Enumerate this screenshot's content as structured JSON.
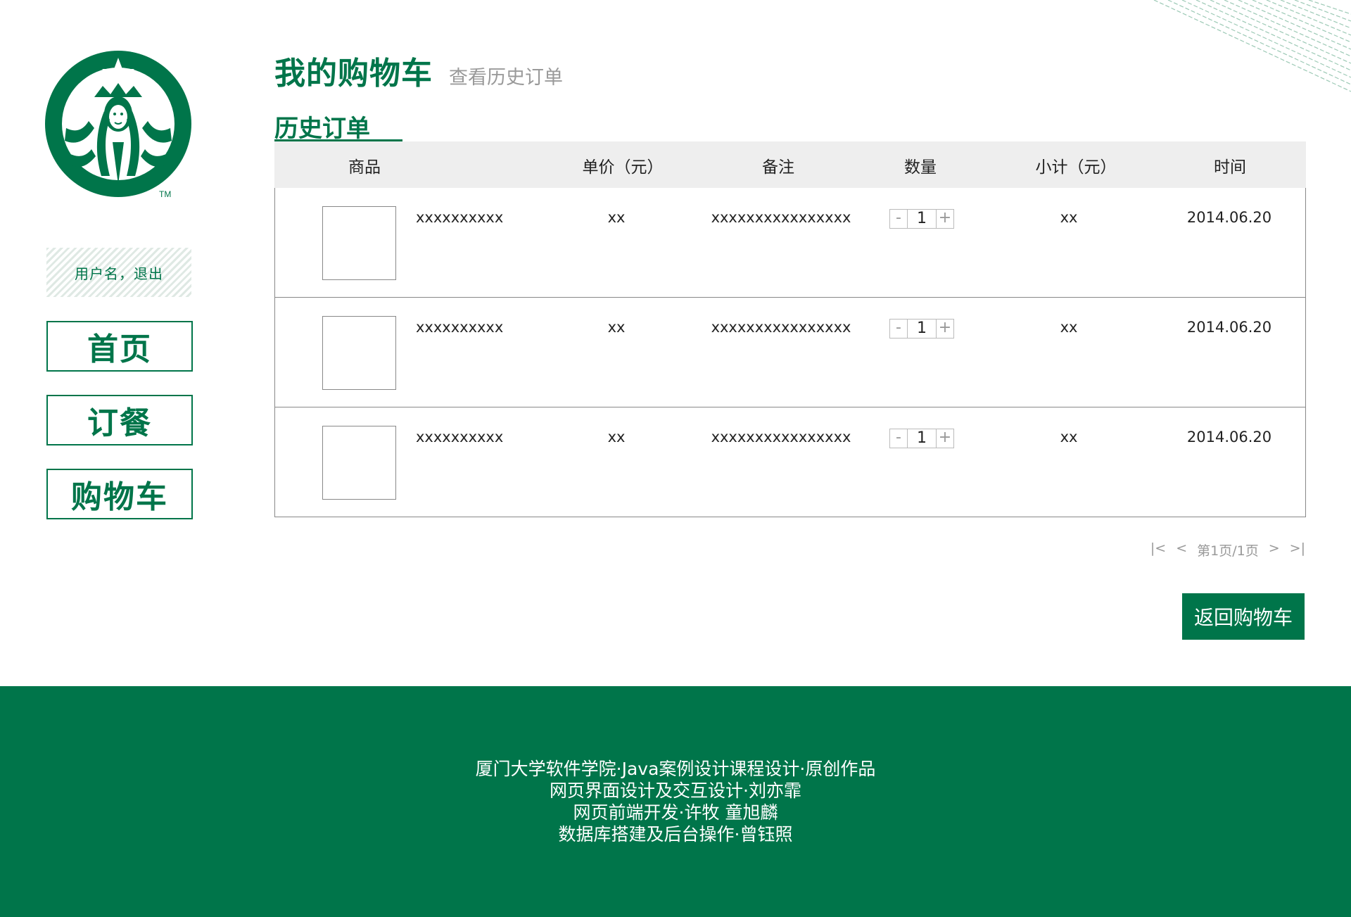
{
  "brand": {
    "accent": "#00754a",
    "logo_mark": "TM"
  },
  "header": {
    "title": "我的购物车",
    "subtitle": "查看历史订单"
  },
  "section": {
    "title": "历史订单"
  },
  "sidebar": {
    "user_text": "用户名，退出",
    "nav": [
      {
        "label": "首页"
      },
      {
        "label": "订餐"
      },
      {
        "label": "购物车"
      }
    ]
  },
  "table": {
    "columns": [
      "商品",
      "单价（元）",
      "备注",
      "数量",
      "小计（元）",
      "时间"
    ],
    "rows": [
      {
        "name": "xxxxxxxxxx",
        "price": "xx",
        "note": "xxxxxxxxxxxxxxxx",
        "quantity": "1",
        "subtotal": "xx",
        "time": "2014.06.20"
      },
      {
        "name": "xxxxxxxxxx",
        "price": "xx",
        "note": "xxxxxxxxxxxxxxxx",
        "quantity": "1",
        "subtotal": "xx",
        "time": "2014.06.20"
      },
      {
        "name": "xxxxxxxxxx",
        "price": "xx",
        "note": "xxxxxxxxxxxxxxxx",
        "quantity": "1",
        "subtotal": "xx",
        "time": "2014.06.20"
      }
    ],
    "qty_minus": "-",
    "qty_plus": "+"
  },
  "pagination": {
    "first": "|<",
    "prev": "<",
    "info": "第1页/1页",
    "next": ">",
    "last": ">|"
  },
  "actions": {
    "back_label": "返回购物车"
  },
  "footer": {
    "lines": [
      "厦门大学软件学院·Java案例设计课程设计·原创作品",
      "网页界面设计及交互设计·刘亦霏",
      "网页前端开发·许牧 童旭麟",
      "数据库搭建及后台操作·曾钰照"
    ]
  }
}
